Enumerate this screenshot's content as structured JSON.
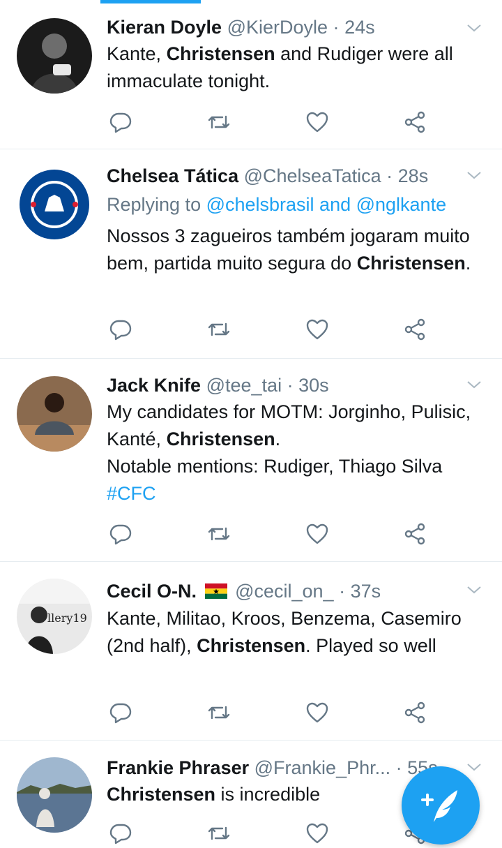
{
  "colors": {
    "accent": "#1da1f2",
    "text": "#14171a",
    "secondary": "#657786",
    "divider": "#e6ecf0"
  },
  "tweets": [
    {
      "name": "Kieran Doyle",
      "handle": "@KierDoyle",
      "separator": "·",
      "time": "24s",
      "text_parts": [
        "Kante, ",
        "Christensen",
        " and Rudiger were all immaculate tonight."
      ]
    },
    {
      "name": "Chelsea Tática",
      "handle": "@ChelseaTatica",
      "separator": "·",
      "time": "28s",
      "reply_prefix": "Replying to ",
      "reply_to": "@chelsbrasil and @nglkante",
      "text_parts": [
        "Nossos 3 zagueiros também jogaram muito bem, partida muito segura do ",
        "Christensen",
        "."
      ]
    },
    {
      "name": "Jack Knife",
      "handle": "@tee_tai",
      "separator": "·",
      "time": "30s",
      "text_parts": [
        "My candidates for MOTM: Jorginho, Pulisic, Kanté, ",
        "Christensen",
        ".",
        "Notable mentions: Rudiger, Thiago Silva",
        "#CFC"
      ]
    },
    {
      "name": "Cecil O-N.",
      "flag": "ghana-flag",
      "handle": "@cecil_on_",
      "separator": "·",
      "time": "37s",
      "text_parts": [
        "Kante, Militao, Kroos, Benzema, Casemiro (2nd half), ",
        "Christensen",
        ". Played so well"
      ]
    },
    {
      "name": "Frankie Phraser",
      "handle": "@Frankie_Phr...",
      "separator": "·",
      "time": "55s",
      "text_parts": [
        "Christensen",
        " is incredible"
      ]
    }
  ],
  "icons": {
    "reply": "reply-icon",
    "retweet": "retweet-icon",
    "like": "heart-icon",
    "share": "share-icon",
    "menu": "chevron-down-icon",
    "compose": "compose-tweet-icon"
  }
}
